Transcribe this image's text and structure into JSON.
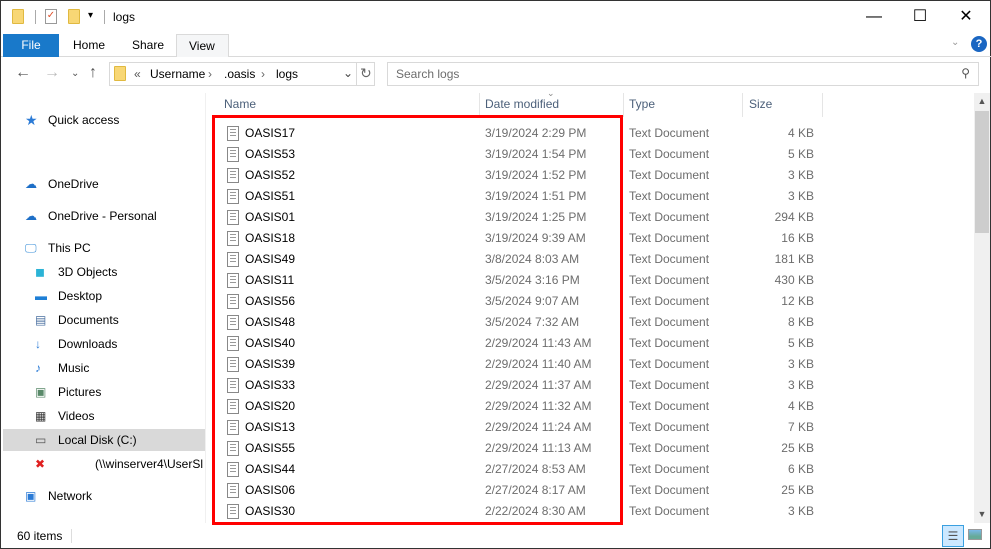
{
  "window": {
    "title": "logs",
    "minimize": "—",
    "maximize": "☐",
    "close": "✕"
  },
  "ribbon": {
    "tabs": [
      "File",
      "Home",
      "Share",
      "View"
    ],
    "help": "?"
  },
  "address": {
    "overflow": "«",
    "crumbs": [
      "Username",
      ".oasis",
      "logs"
    ],
    "search_placeholder": "Search logs"
  },
  "sidebar": [
    {
      "label": "Quick access",
      "icon": "star-icon"
    },
    {
      "label": "OneDrive",
      "icon": "cloud-icon"
    },
    {
      "label": "OneDrive - Personal",
      "icon": "cloud-icon"
    },
    {
      "label": "This PC",
      "icon": "computer-icon"
    },
    {
      "label": "3D Objects",
      "icon": "cube-icon"
    },
    {
      "label": "Desktop",
      "icon": "desktop-icon"
    },
    {
      "label": "Documents",
      "icon": "document-icon"
    },
    {
      "label": "Downloads",
      "icon": "download-icon"
    },
    {
      "label": "Music",
      "icon": "music-icon"
    },
    {
      "label": "Pictures",
      "icon": "pictures-icon"
    },
    {
      "label": "Videos",
      "icon": "video-icon"
    },
    {
      "label": "Local Disk (C:)",
      "icon": "drive-icon"
    },
    {
      "label": "(\\\\winserver4\\UserSl",
      "icon": "network-drive-disconnected-icon"
    },
    {
      "label": "Network",
      "icon": "network-icon"
    }
  ],
  "columns": {
    "name": "Name",
    "date": "Date modified",
    "type": "Type",
    "size": "Size"
  },
  "files": [
    {
      "name": "OASIS17",
      "date": "3/19/2024 2:29 PM",
      "type": "Text Document",
      "size": "4 KB"
    },
    {
      "name": "OASIS53",
      "date": "3/19/2024 1:54 PM",
      "type": "Text Document",
      "size": "5 KB"
    },
    {
      "name": "OASIS52",
      "date": "3/19/2024 1:52 PM",
      "type": "Text Document",
      "size": "3 KB"
    },
    {
      "name": "OASIS51",
      "date": "3/19/2024 1:51 PM",
      "type": "Text Document",
      "size": "3 KB"
    },
    {
      "name": "OASIS01",
      "date": "3/19/2024 1:25 PM",
      "type": "Text Document",
      "size": "294 KB"
    },
    {
      "name": "OASIS18",
      "date": "3/19/2024 9:39 AM",
      "type": "Text Document",
      "size": "16 KB"
    },
    {
      "name": "OASIS49",
      "date": "3/8/2024 8:03 AM",
      "type": "Text Document",
      "size": "181 KB"
    },
    {
      "name": "OASIS11",
      "date": "3/5/2024 3:16 PM",
      "type": "Text Document",
      "size": "430 KB"
    },
    {
      "name": "OASIS56",
      "date": "3/5/2024 9:07 AM",
      "type": "Text Document",
      "size": "12 KB"
    },
    {
      "name": "OASIS48",
      "date": "3/5/2024 7:32 AM",
      "type": "Text Document",
      "size": "8 KB"
    },
    {
      "name": "OASIS40",
      "date": "2/29/2024 11:43 AM",
      "type": "Text Document",
      "size": "5 KB"
    },
    {
      "name": "OASIS39",
      "date": "2/29/2024 11:40 AM",
      "type": "Text Document",
      "size": "3 KB"
    },
    {
      "name": "OASIS33",
      "date": "2/29/2024 11:37 AM",
      "type": "Text Document",
      "size": "3 KB"
    },
    {
      "name": "OASIS20",
      "date": "2/29/2024 11:32 AM",
      "type": "Text Document",
      "size": "4 KB"
    },
    {
      "name": "OASIS13",
      "date": "2/29/2024 11:24 AM",
      "type": "Text Document",
      "size": "7 KB"
    },
    {
      "name": "OASIS55",
      "date": "2/29/2024 11:13 AM",
      "type": "Text Document",
      "size": "25 KB"
    },
    {
      "name": "OASIS44",
      "date": "2/27/2024 8:53 AM",
      "type": "Text Document",
      "size": "6 KB"
    },
    {
      "name": "OASIS06",
      "date": "2/27/2024 8:17 AM",
      "type": "Text Document",
      "size": "25 KB"
    },
    {
      "name": "OASIS30",
      "date": "2/22/2024 8:30 AM",
      "type": "Text Document",
      "size": "3 KB"
    }
  ],
  "status": {
    "count": "60 items"
  },
  "colors": {
    "accent": "#0063b1",
    "highlight": "#ff0000"
  }
}
